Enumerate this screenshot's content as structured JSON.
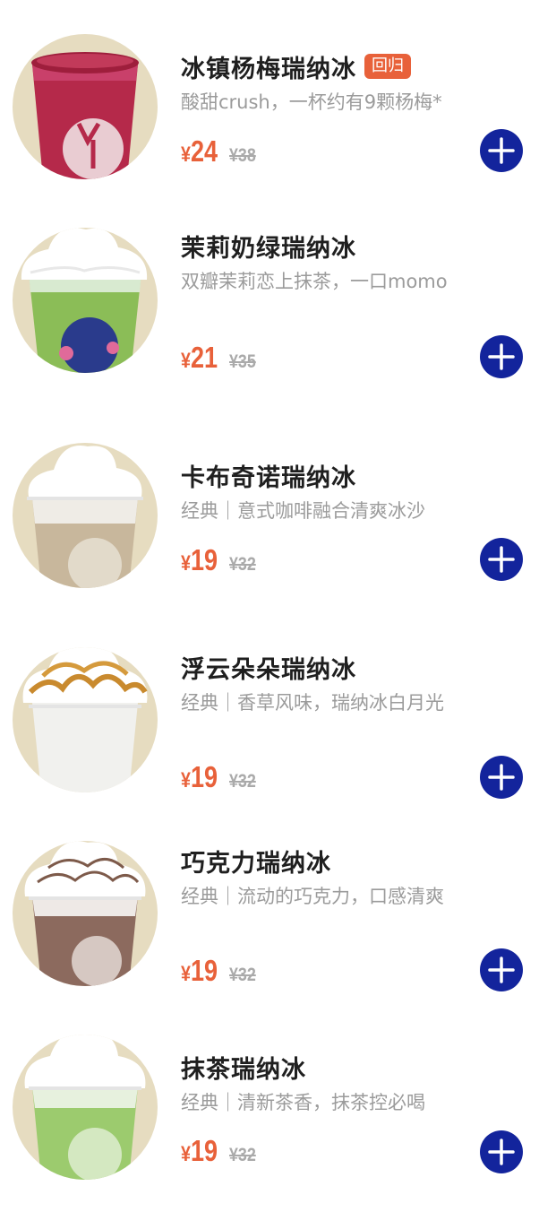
{
  "colors": {
    "accent_price": "#e8613a",
    "add_button": "#13249c",
    "thumb_bg": "#e6dcc0",
    "description": "#9b9b9b"
  },
  "currency_symbol": "¥",
  "items": [
    {
      "name": "冰镇杨梅瑞纳冰",
      "badge": "回归",
      "desc": "酸甜crush，一杯约有9颗杨梅*",
      "price": "24",
      "orig": "¥38",
      "image": "red-drink-icon",
      "add_icon": "plus-icon"
    },
    {
      "name": "茉莉奶绿瑞纳冰",
      "badge": "",
      "desc": "双瓣茉莉恋上抹茶，一口momo",
      "price": "21",
      "orig": "¥35",
      "image": "green-cream-drink-icon",
      "add_icon": "plus-icon"
    },
    {
      "name": "卡布奇诺瑞纳冰",
      "badge": "",
      "desc": "经典｜意式咖啡融合清爽冰沙",
      "price": "19",
      "orig": "¥32",
      "image": "latte-cream-drink-icon",
      "add_icon": "plus-icon"
    },
    {
      "name": "浮云朵朵瑞纳冰",
      "badge": "",
      "desc": "经典｜香草风味，瑞纳冰白月光",
      "price": "19",
      "orig": "¥32",
      "image": "caramel-cream-drink-icon",
      "add_icon": "plus-icon"
    },
    {
      "name": "巧克力瑞纳冰",
      "badge": "",
      "desc": "经典｜流动的巧克力，口感清爽",
      "price": "19",
      "orig": "¥32",
      "image": "chocolate-cream-drink-icon",
      "add_icon": "plus-icon"
    },
    {
      "name": "抹茶瑞纳冰",
      "badge": "",
      "desc": "经典｜清新茶香，抹茶控必喝",
      "price": "19",
      "orig": "¥32",
      "image": "matcha-cream-drink-icon",
      "add_icon": "plus-icon"
    }
  ]
}
